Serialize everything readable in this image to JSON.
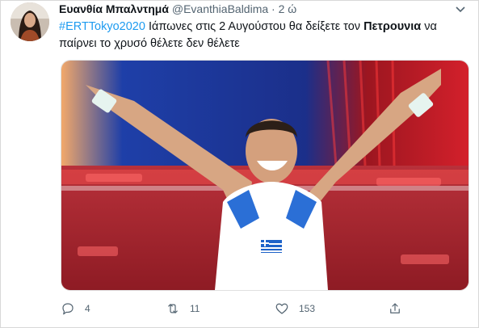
{
  "tweet": {
    "display_name": "Ευανθία Μπαλντημά",
    "handle": "@EvanthiaBaldima",
    "separator": "·",
    "time": "2 ώ",
    "hashtag": "#ERTTokyo2020",
    "text_part1": " Ιάπωνες στις 2 Αυγούστου θα δείξετε τον ",
    "bold_word": "Πετρουνια",
    "text_part2": " να παίρνει το χρυσό θέλετε δεν θέλετε"
  },
  "media": {
    "description_icon": "photo",
    "shirt_colors": [
      "#ffffff",
      "#2b6fd6"
    ],
    "background_colors": [
      "#1b2f8a",
      "#d3202b"
    ]
  },
  "actions": {
    "reply_count": "4",
    "retweet_count": "11",
    "like_count": "153"
  },
  "colors": {
    "accent": "#1d9bf0",
    "secondary_text": "#536471"
  }
}
